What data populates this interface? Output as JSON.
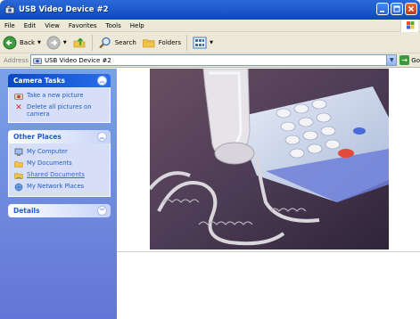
{
  "window": {
    "title": "USB Video Device #2"
  },
  "menu": {
    "items": [
      "File",
      "Edit",
      "View",
      "Favorites",
      "Tools",
      "Help"
    ]
  },
  "toolbar": {
    "back_label": "Back",
    "search_label": "Search",
    "folders_label": "Folders"
  },
  "address": {
    "label": "Address",
    "value": "USB Video Device #2",
    "go_label": "Go"
  },
  "taskpane": {
    "camera_tasks": {
      "title": "Camera Tasks",
      "items": [
        {
          "label": "Take a new picture",
          "icon": "camera-icon"
        },
        {
          "label": "Delete all pictures on camera",
          "icon": "delete-x-icon"
        }
      ]
    },
    "other_places": {
      "title": "Other Places",
      "items": [
        {
          "label": "My Computer",
          "icon": "computer-icon"
        },
        {
          "label": "My Documents",
          "icon": "folder-icon"
        },
        {
          "label": "Shared Documents",
          "icon": "folder-icon"
        },
        {
          "label": "My Network Places",
          "icon": "network-icon"
        }
      ]
    },
    "details": {
      "title": "Details"
    }
  },
  "colors": {
    "titlebar": "#1f5cd0",
    "taskpane": "#6f8fe0",
    "link": "#215dc6"
  }
}
